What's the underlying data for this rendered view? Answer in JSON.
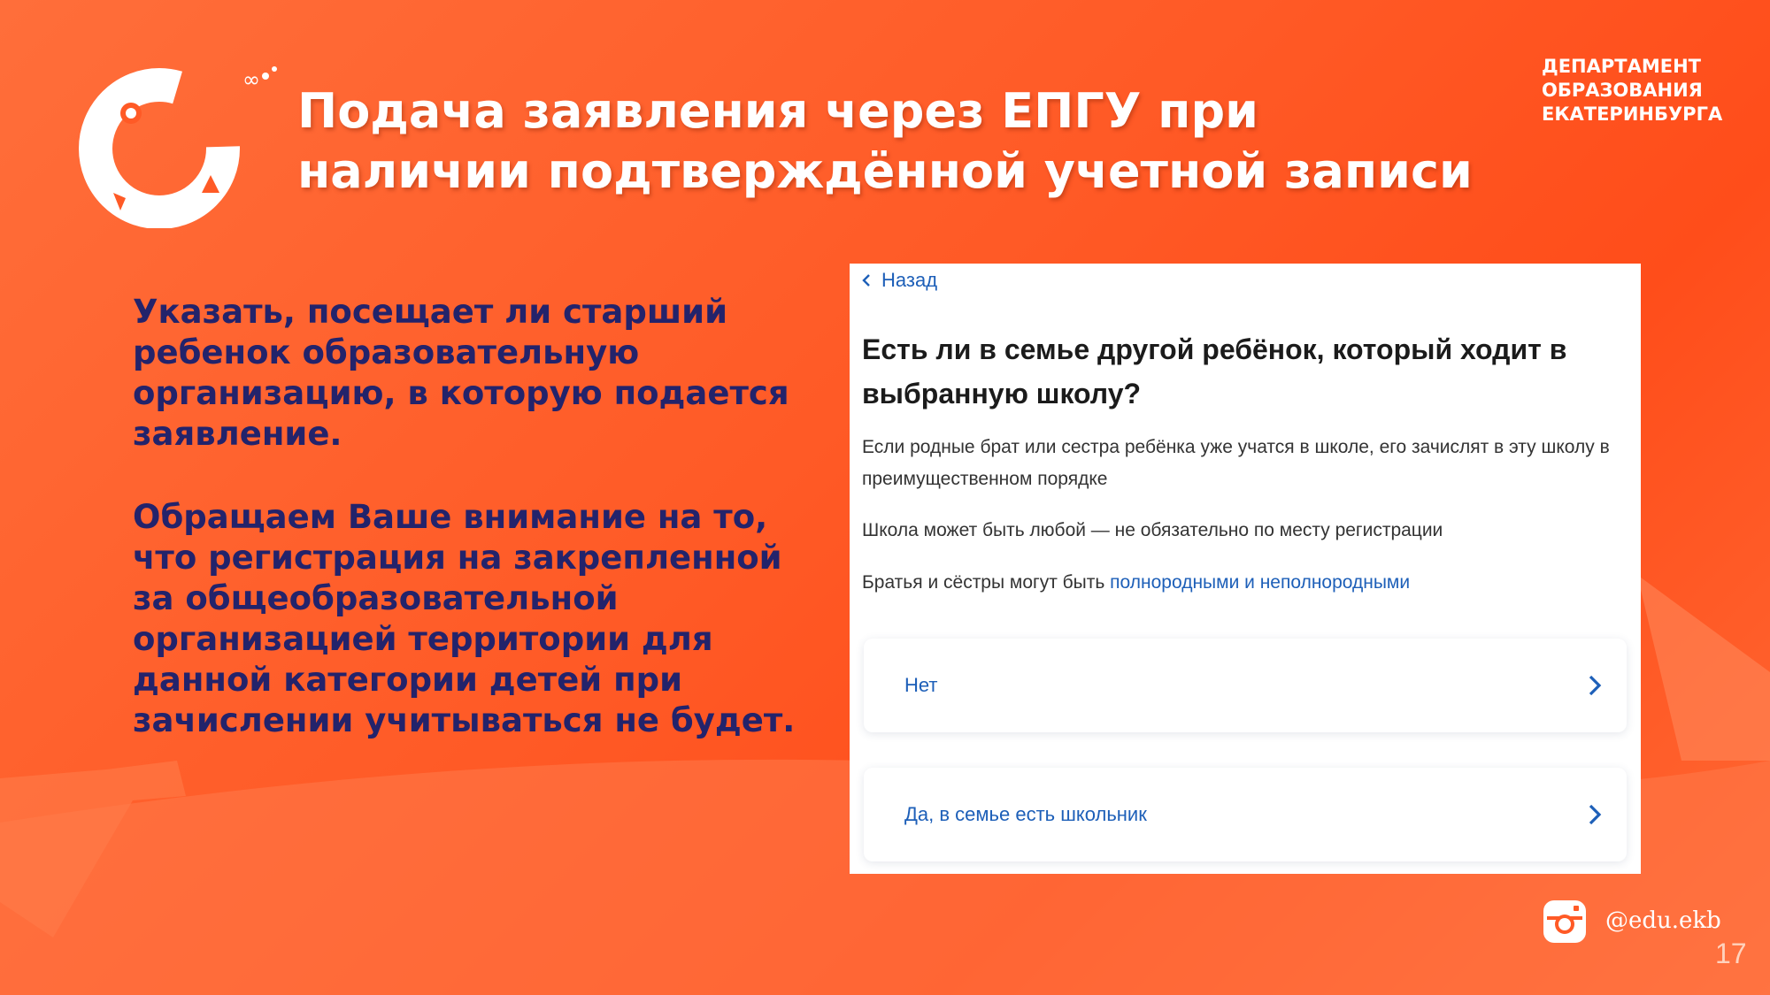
{
  "slide": {
    "title": "Подача заявления через ЕПГУ при наличии подтверждённой учетной записи",
    "department": "ДЕПАРТАМЕНТ ОБРАЗОВАНИЯ ЕКАТЕРИНБУРГА",
    "paragraph1": "Указать, посещает ли старший ребенок образовательную организацию, в которую подается заявление.",
    "paragraph2": "Обращаем Ваше внимание на то, что регистрация на закрепленной за общеобразовательной организацией территории для данной категории детей при зачислении учитываться не будет.",
    "social_handle": "@edu.ekb",
    "page_number": "17"
  },
  "screenshot": {
    "back_label": "Назад",
    "question": "Есть ли в семье другой ребёнок, который ходит в выбранную школу?",
    "hint1": "Если родные брат или сестра ребёнка уже учатся в школе, его зачислят в эту школу в преимущественном порядке",
    "hint2": "Школа может быть любой — не обязательно по месту регистрации",
    "hint3_prefix": "Братья и сёстры могут быть ",
    "hint3_link": "полнородными и неполнородными",
    "options": [
      {
        "label": "Нет"
      },
      {
        "label": "Да, в семье есть школьник"
      }
    ]
  },
  "icons": [
    "logo-ring-icon",
    "chevron-left-icon",
    "chevron-right-icon",
    "instagram-icon"
  ],
  "colors": {
    "background": "#ff5a26",
    "title": "#ffffff",
    "body_text": "#23236b",
    "link": "#1d5fb8"
  }
}
